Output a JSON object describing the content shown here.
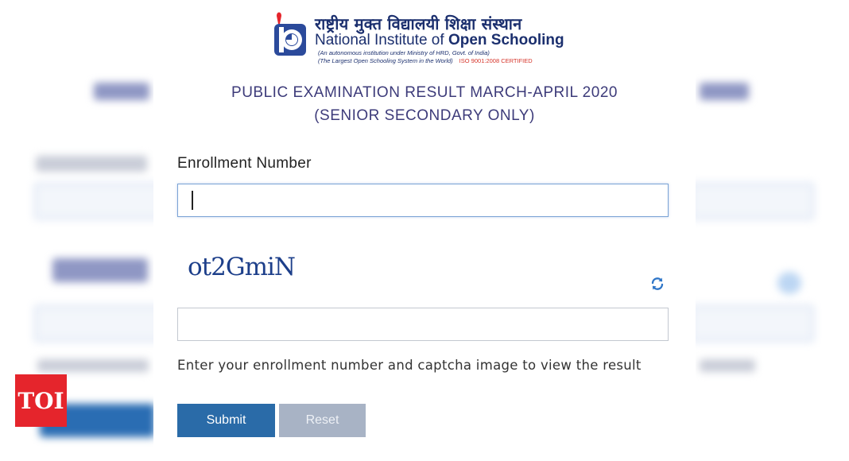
{
  "logo": {
    "hindi_name": "राष्ट्रीय मुक्त विद्यालयी शिक्षा संस्थान",
    "name_part1": "National Institute of ",
    "name_part2": "Open Schooling",
    "subtitle1": "(An autonomous institution under  Ministry of HRD, Govt. of India)",
    "subtitle2": "(The Largest Open Schooling System in the World)",
    "iso": "ISO 9001:2008 CERTIFIED"
  },
  "heading": {
    "line1": "PUBLIC EXAMINATION RESULT MARCH-APRIL 2020",
    "line2": "(SENIOR SECONDARY ONLY)"
  },
  "form": {
    "enrollment_label": "Enrollment Number",
    "enrollment_value": "",
    "captcha_text": "ot2GmiN",
    "captcha_value": "",
    "help_text": "Enter your enrollment number and captcha image to view the result",
    "submit_label": "Submit",
    "reset_label": "Reset"
  },
  "watermark": {
    "label": "TOI"
  },
  "colors": {
    "accent": "#2a6ba8",
    "heading": "#3d3b7a",
    "brand_red": "#e5252c",
    "reset_button": "#a8b3c5"
  },
  "icons": {
    "refresh": "refresh-icon",
    "logo": "nios-emblem-icon"
  }
}
